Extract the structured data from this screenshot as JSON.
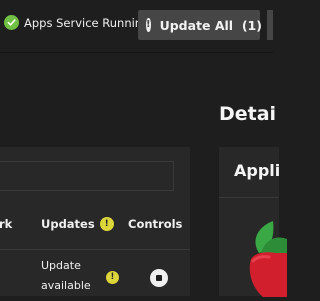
{
  "header": {
    "service_status": "Apps Service Running",
    "update_all_label": "Update All",
    "update_count": "(1)"
  },
  "apps_table": {
    "columns": {
      "network_partial": "rk",
      "updates": "Updates",
      "controls": "Controls"
    },
    "rows": [
      {
        "update_status": "Update available"
      }
    ]
  },
  "details": {
    "title": "Detai",
    "card_title": "Appli"
  },
  "colors": {
    "status_ok": "#71bf44",
    "warning": "#ddd63b",
    "button_bg": "#464646",
    "background": "#1e1e1e",
    "panel_bg": "#282828"
  },
  "icons": {
    "status": "check-circle-icon",
    "update_all": "alert-circle-icon",
    "updates_header": "exclamation-circle-icon",
    "row_update": "exclamation-circle-icon",
    "controls": "stop-icon",
    "app_logo": "app-logo-icon"
  }
}
